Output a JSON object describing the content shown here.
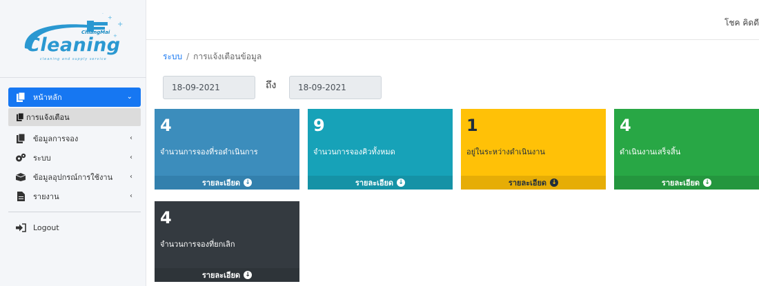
{
  "logo": {
    "brand_small": "ChiangMai",
    "brand_big": "Cleaning",
    "tagline": "cleaning and supply service"
  },
  "sidebar": {
    "items": [
      {
        "label": "หน้าหลัก",
        "icon": "copy-icon"
      },
      {
        "label": "การแจ้งเตือน",
        "icon": "copy-icon"
      },
      {
        "label": "ข้อมูลการจอง",
        "icon": "copy-icon"
      },
      {
        "label": "ระบบ",
        "icon": "cogs-icon"
      },
      {
        "label": "ข้อมูลอุปกรณ์การใช้งาน",
        "icon": "box-icon"
      },
      {
        "label": "รายงาน",
        "icon": "file-icon"
      },
      {
        "label": "Logout",
        "icon": "sign-in-icon"
      }
    ]
  },
  "header": {
    "user_name": "โชค คิดดี"
  },
  "breadcrumb": {
    "root": "ระบบ",
    "separator": "/",
    "current": "การแจ้งเตือนข้อมูล"
  },
  "filter": {
    "date_from": "18-09-2021",
    "to_label": "ถึง",
    "date_to": "18-09-2021"
  },
  "cards": [
    {
      "value": "4",
      "label": "จำนวนการจองที่รอดำเนินการ",
      "link": "รายละเอียด",
      "color": "#3c8dbc"
    },
    {
      "value": "9",
      "label": "จำนวนการจองคิวทั้งหมด",
      "link": "รายละเอียด",
      "color": "#17a2b8"
    },
    {
      "value": "1",
      "label": "อยู่ในระหว่างดำเนินงาน",
      "link": "รายละเอียด",
      "color": "#ffc107"
    },
    {
      "value": "4",
      "label": "ดำเนินงานเสร็จสิ้น",
      "link": "รายละเอียด",
      "color": "#28a745"
    },
    {
      "value": "4",
      "label": "จำนวนการจองที่ยกเลิก",
      "link": "รายละเอียด",
      "color": "#343a40"
    }
  ]
}
